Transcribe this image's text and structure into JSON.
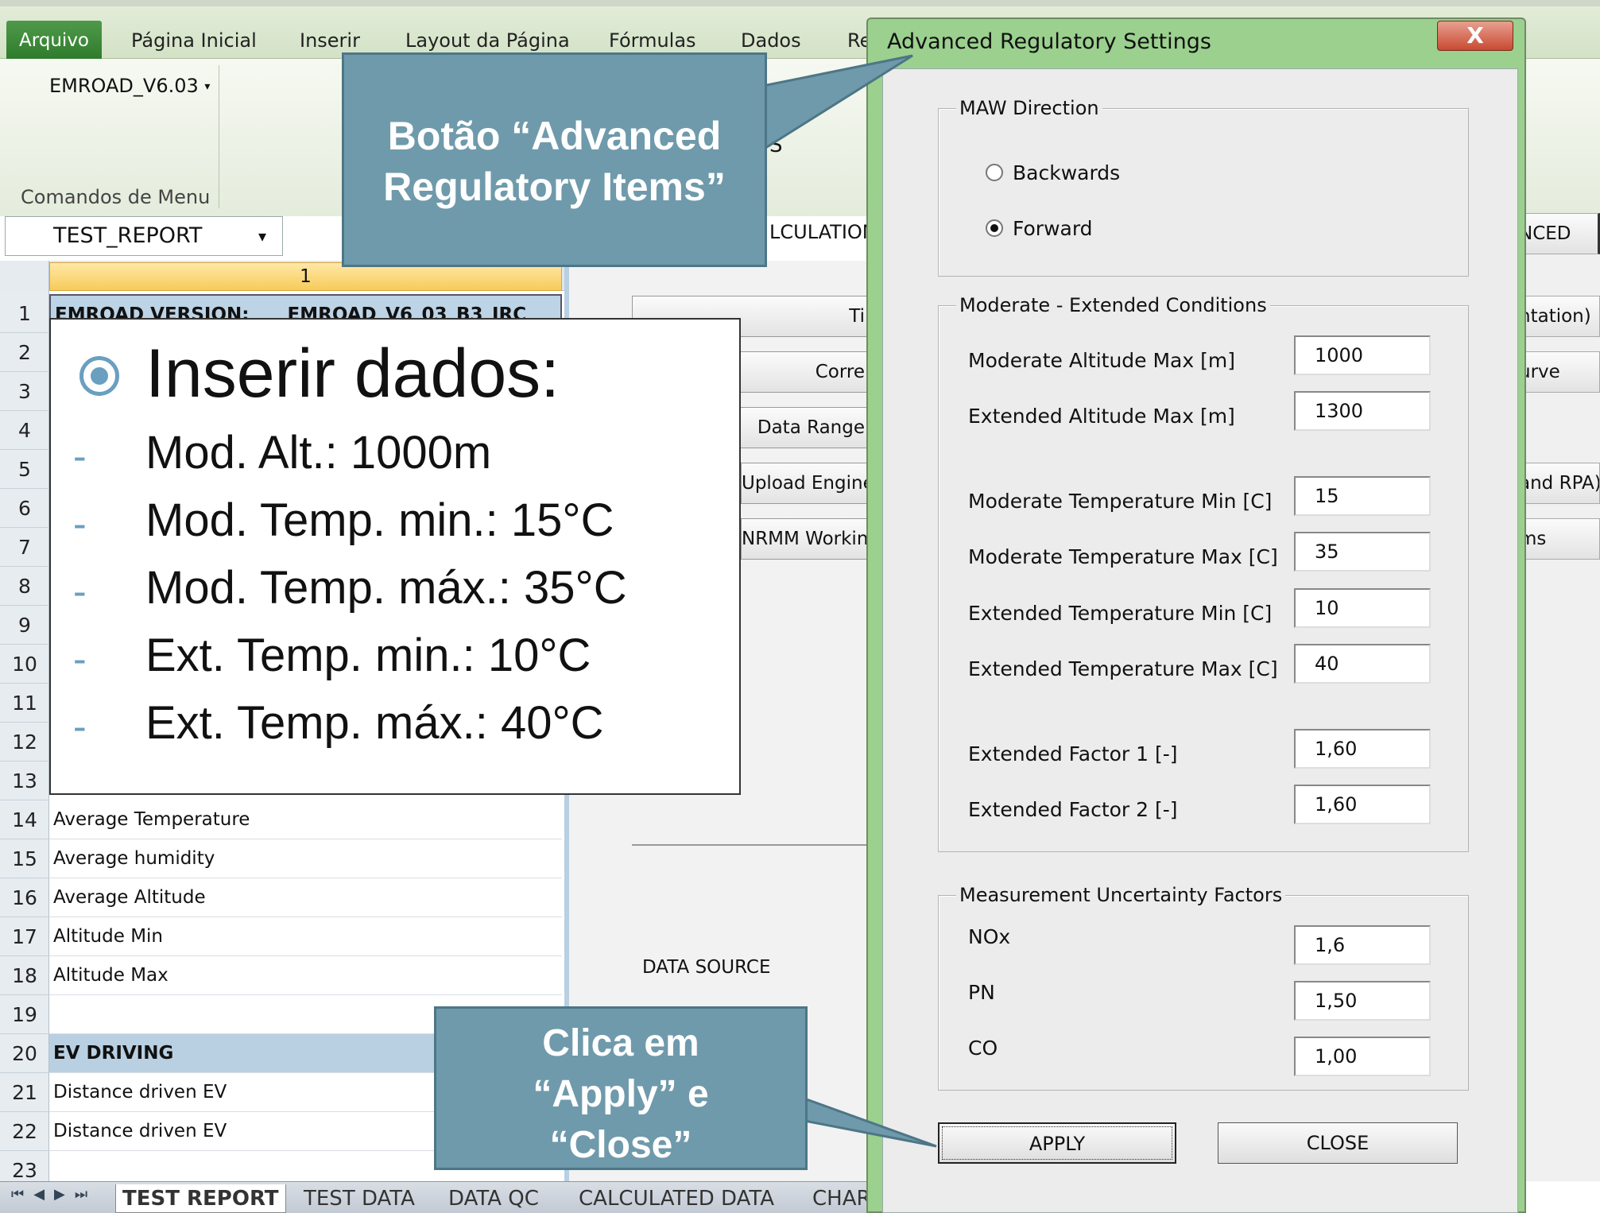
{
  "ribbon": {
    "tabs": [
      "Arquivo",
      "Página Inicial",
      "Inserir",
      "Layout da Página",
      "Fórmulas",
      "Dados",
      "Re"
    ],
    "addin_menu": "EMROAD_V6.03",
    "group_label": "Comandos de Menu"
  },
  "namebox": "TEST_REPORT",
  "sheet": {
    "column_header": "1",
    "row_numbers": [
      "1",
      "2",
      "3",
      "4",
      "5",
      "6",
      "7",
      "8",
      "9",
      "10",
      "11",
      "12",
      "13",
      "14",
      "15",
      "16",
      "17",
      "18",
      "19",
      "20",
      "21",
      "22",
      "23"
    ],
    "row1_label": "EMROAD VERSION:",
    "row1_value": "EMROAD_V6_03_B3_JRC",
    "rows": {
      "r14": "Average Temperature",
      "r15": "Average humidity",
      "r16": "Average Altitude",
      "r17": "Altitude Min",
      "r18": "Altitude Max",
      "r20": "EV DRIVING",
      "r21": "Distance driven EV",
      "r22": "Distance driven EV"
    },
    "side_text": {
      "s_fragment": "S",
      "calculation_fragment": "LCULATION",
      "data_source": "DATA SOURCE"
    },
    "side_buttons": [
      "Ti",
      "Corre",
      "Data Range",
      "Upload Engine",
      "NRMM Workin"
    ],
    "right_buttons": [
      "NCED",
      "ntation)",
      "urve",
      "and RPA)",
      "ms"
    ]
  },
  "sheet_tabs": [
    "TEST REPORT",
    "TEST DATA",
    "DATA QC",
    "CALCULATED DATA",
    "CHAR"
  ],
  "dialog": {
    "title": "Advanced Regulatory Settings",
    "close_glyph": "X",
    "maw_direction": {
      "legend": "MAW Direction",
      "options": [
        "Backwards",
        "Forward"
      ],
      "selected": "Forward"
    },
    "conditions": {
      "legend": "Moderate - Extended Conditions",
      "fields": [
        {
          "label": "Moderate Altitude Max [m]",
          "value": "1000"
        },
        {
          "label": "Extended Altitude Max [m]",
          "value": "1300"
        },
        {
          "label": "Moderate Temperature Min [C]",
          "value": "15"
        },
        {
          "label": "Moderate Temperature Max [C]",
          "value": "35"
        },
        {
          "label": "Extended Temperature Min [C]",
          "value": "10"
        },
        {
          "label": "Extended Temperature Max [C]",
          "value": "40"
        },
        {
          "label": "Extended Factor 1 [-]",
          "value": "1,60"
        },
        {
          "label": "Extended Factor 2 [-]",
          "value": "1,60"
        }
      ]
    },
    "uncertainty": {
      "legend": "Measurement Uncertainty Factors",
      "fields": [
        {
          "label": "NOx",
          "value": "1,6"
        },
        {
          "label": "PN",
          "value": "1,50"
        },
        {
          "label": "CO",
          "value": "1,00"
        }
      ]
    },
    "apply_label": "APPLY",
    "close_label": "CLOSE"
  },
  "callouts": {
    "top_line1": "Botão “Advanced",
    "top_line2": "Regulatory Items”",
    "bottom_line1": "Clica em",
    "bottom_line2": "“Apply” e",
    "bottom_line3": "“Close”"
  },
  "info": {
    "heading": "Inserir dados:",
    "items": [
      "Mod. Alt.: 1000m",
      "Mod. Temp. min.: 15°C",
      "Mod. Temp. máx.: 35°C",
      "Ext. Temp. min.: 10°C",
      "Ext. Temp. máx.: 40°C"
    ],
    "dash": "-"
  },
  "colors": {
    "callout_fill": "#6f9aab",
    "dialog_frame": "#9bd08e",
    "bullet_accent": "#6a9fbf",
    "excel_file_tab": "#2e7a2c"
  }
}
